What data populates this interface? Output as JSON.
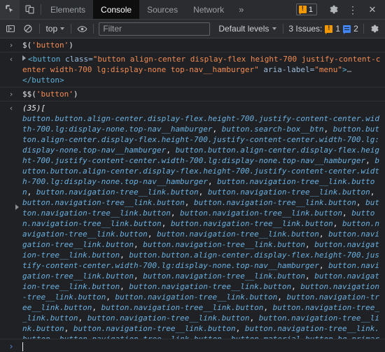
{
  "main_toolbar": {
    "icons": [
      {
        "name": "inspect-element-icon",
        "label": "Inspect element"
      },
      {
        "name": "device-toolbar-icon",
        "label": "Toggle device toolbar"
      }
    ],
    "tabs": [
      {
        "label": "Elements",
        "selected": false
      },
      {
        "label": "Console",
        "selected": true
      },
      {
        "label": "Sources",
        "selected": false
      },
      {
        "label": "Network",
        "selected": false
      }
    ],
    "more_tabs_glyph": "»",
    "warning_badge_count": "1",
    "settings_label": "Settings",
    "more_options_glyph": "⋮",
    "close_glyph": "✕"
  },
  "console_toolbar": {
    "sidebar_toggle_label": "Show console sidebar",
    "clear_label": "Clear console",
    "context_selector": "top",
    "eye_label": "Create live expression",
    "filter_placeholder": "Filter",
    "filter_value": "",
    "levels_label": "Default levels",
    "issues_label": "3 Issues:",
    "issues_warning_count": "1",
    "issues_info_count": "2",
    "settings_label": "Console settings"
  },
  "console": {
    "entries": [
      {
        "type": "input",
        "gutter": "›",
        "command_prefix": "$(",
        "command_string": "'button'",
        "command_suffix": ")"
      },
      {
        "type": "output-node",
        "gutter": "‹",
        "tag_open": "<button",
        "attr1_name": " class=",
        "attr1_value": "\"button align-center display-flex height-700 justify-content-center width-700 lg:display-none top-nav__hamburger\"",
        "attr2_name": " aria-label=",
        "attr2_value": "\"menu\"",
        "tag_close_bracket": ">",
        "ellipsis": "…",
        "closing_tag": "</button>"
      },
      {
        "type": "input",
        "gutter": "›",
        "command_prefix": "$$(",
        "command_string": "'button'",
        "command_suffix": ")"
      },
      {
        "type": "output-array",
        "gutter": "‹",
        "count_label": "(35)",
        "open_bracket": "[",
        "close_bracket": "]",
        "items": [
          "button.button.align-center.display-flex.height-700.justify-content-center.width-700.lg:display-none.top-nav__hamburger",
          "button.search-box__btn",
          "button.button.align-center.display-flex.height-700.justify-content-center.width-700.lg:display-none.top-nav__hamburger",
          "button.button.align-center.display-flex.height-700.justify-content-center.width-700.lg:display-none.top-nav__hamburger",
          "button.button.align-center.display-flex.height-700.justify-content-center.width-700.lg:display-none.top-nav__hamburger",
          "button.navigation-tree__link.button",
          "button.navigation-tree__link.button",
          "button.navigation-tree__link.button",
          "button.navigation-tree__link.button",
          "button.navigation-tree__link.button",
          "button.navigation-tree__link.button",
          "button.navigation-tree__link.button",
          "button.navigation-tree__link.button",
          "button.navigation-tree__link.button",
          "button.navigation-tree__link.button",
          "button.navigation-tree__link.button",
          "button.navigation-tree__link.button",
          "button.navigation-tree__link.button",
          "button.navigation-tree__link.button",
          "button.button.align-center.display-flex.height-700.justify-content-center.width-700.lg:display-none.top-nav__hamburger",
          "button.navigation-tree__link.button",
          "button.navigation-tree__link.button",
          "button.navigation-tree__link.button",
          "button.navigation-tree__link.button",
          "button.navigation-tree__link.button",
          "button.navigation-tree__link.button",
          "button.navigation-tree__link.button",
          "button.navigation-tree__link.button",
          "button.navigation-tree__link.button",
          "button.navigation-tree__link.button",
          "button.navigation-tree__link.button",
          "button.navigation-tree__link.button",
          "button.navigation-tree__link.button",
          "button.navigation-tree__link.button",
          "button.material-button.bg-primary.button-filled.color-bg"
        ]
      }
    ],
    "prompt_chevron": "›",
    "prompt_value": ""
  },
  "colors": {
    "background": "#202124",
    "toolbar": "#2b2c2f",
    "selected_tab": "#0e0e0e",
    "text": "#e8eaed",
    "muted_text": "#9aa0a6",
    "string_orange": "#f28b54",
    "node_blue": "#5db0d7",
    "array_blue": "#6ab0e0",
    "warning_orange": "#f29900",
    "info_blue": "#4285f4",
    "prompt_blue": "#5a8ad6"
  }
}
